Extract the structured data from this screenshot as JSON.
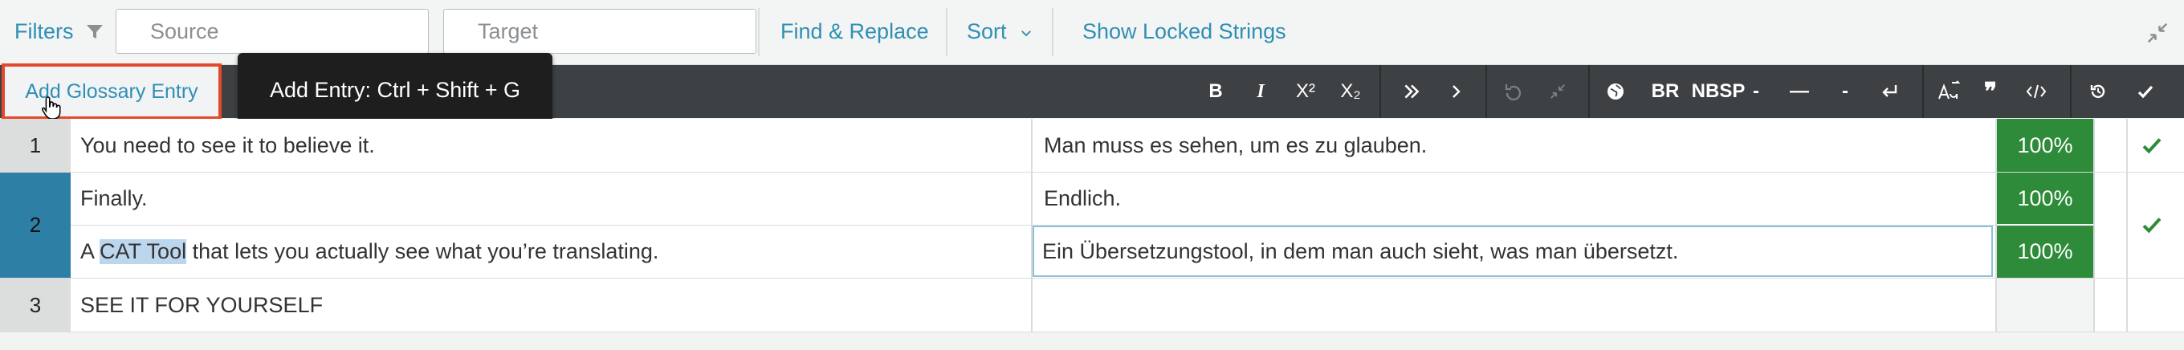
{
  "filterbar": {
    "filters_label": "Filters",
    "source_placeholder": "Source",
    "target_placeholder": "Target",
    "find_replace": "Find & Replace",
    "sort": "Sort",
    "show_locked": "Show Locked Strings"
  },
  "toolbar": {
    "add_glossary": "Add Glossary Entry",
    "tooltip": "Add Entry: Ctrl + Shift + G",
    "bold": "B",
    "italic": "I",
    "superscript": "X²",
    "subscript": "X₂",
    "br": "BR",
    "nbsp": "NBSP",
    "hyphen": "-",
    "em_dash": "—",
    "en_dash": "-"
  },
  "rows": [
    {
      "num": "1",
      "segments": [
        {
          "source": "You need to see it to believe it.",
          "target": "Man muss es sehen, um es zu glauben.",
          "match": "100%"
        }
      ]
    },
    {
      "num": "2",
      "segments": [
        {
          "source": "Finally.",
          "target": "Endlich.",
          "match": "100%"
        },
        {
          "source_pre": "A ",
          "source_hl": "CAT Tool",
          "source_post": " that lets you actually see what you’re translating.",
          "target": "Ein Übersetzungstool, in dem man auch sieht, was man übersetzt.",
          "match": "100%"
        }
      ]
    },
    {
      "num": "3",
      "segments": [
        {
          "source": "SEE IT FOR YOURSELF",
          "target": "",
          "match": ""
        }
      ]
    }
  ],
  "colors": {
    "accent": "#2f8fb4",
    "match_green": "#2e8b3a",
    "toolbar": "#3e4143",
    "highlight_border": "#e4492b"
  }
}
